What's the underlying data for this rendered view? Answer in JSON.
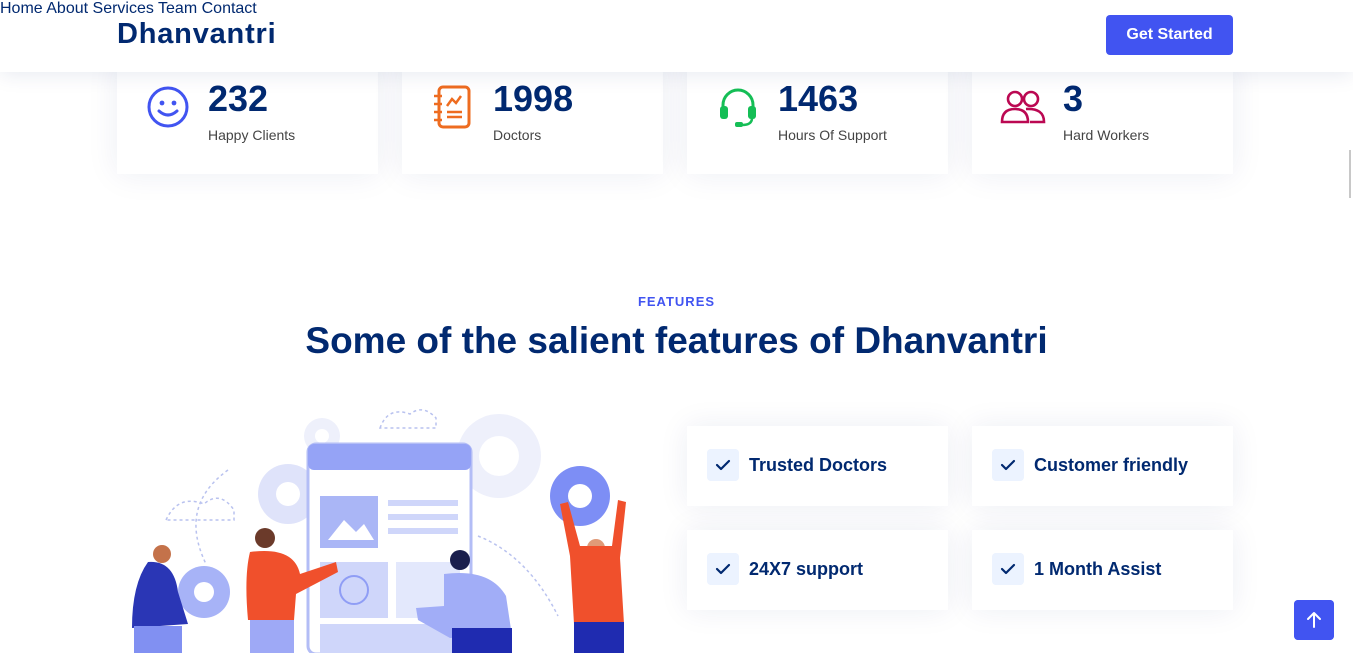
{
  "header": {
    "logo": "Dhanvantri",
    "nav": [
      {
        "label": "Home"
      },
      {
        "label": "About"
      },
      {
        "label": "Services"
      },
      {
        "label": "Team"
      },
      {
        "label": "Contact"
      }
    ],
    "cta_label": "Get Started"
  },
  "stats": [
    {
      "value": "232",
      "label": "Happy Clients",
      "icon": "smile-icon",
      "color": "#4154f1"
    },
    {
      "value": "1998",
      "label": "Doctors",
      "icon": "journal-richtext-icon",
      "color": "#ee6c20"
    },
    {
      "value": "1463",
      "label": "Hours Of Support",
      "icon": "headset-icon",
      "color": "#15be56"
    },
    {
      "value": "3",
      "label": "Hard Workers",
      "icon": "people-icon",
      "color": "#bb0852"
    }
  ],
  "features": {
    "tag": "FEATURES",
    "title": "Some of the salient features of Dhanvantri",
    "items": [
      {
        "label": "Trusted Doctors"
      },
      {
        "label": "Customer friendly"
      },
      {
        "label": "24X7 support"
      },
      {
        "label": "1 Month Assist"
      }
    ]
  },
  "colors": {
    "primary": "#4154f1",
    "heading": "#012970"
  }
}
